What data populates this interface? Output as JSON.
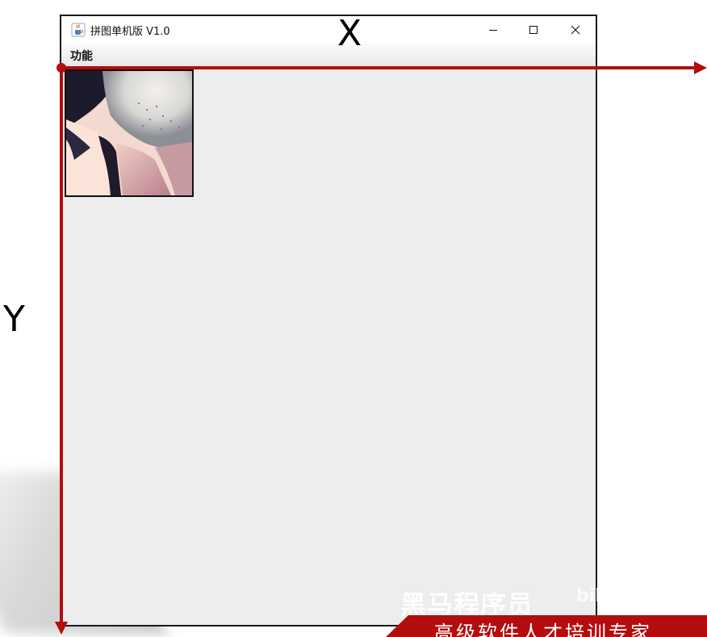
{
  "window": {
    "title": "拼图单机版 V1.0",
    "menu": [
      "功能"
    ],
    "controls": {
      "minimize": "—",
      "maximize": "☐",
      "close": "✕"
    }
  },
  "annotation": {
    "x_axis_label": "X",
    "y_axis_label": "Y",
    "arrow_color": "#b30d0d"
  },
  "watermark": {
    "brand": "黑马程序员",
    "logo_text": "bilibili"
  },
  "banner": {
    "text": "高级软件人才培训专家",
    "color": "#b30d0d"
  },
  "icons": {
    "app": "java-cup-icon",
    "tile": "puzzle-image-tile"
  }
}
